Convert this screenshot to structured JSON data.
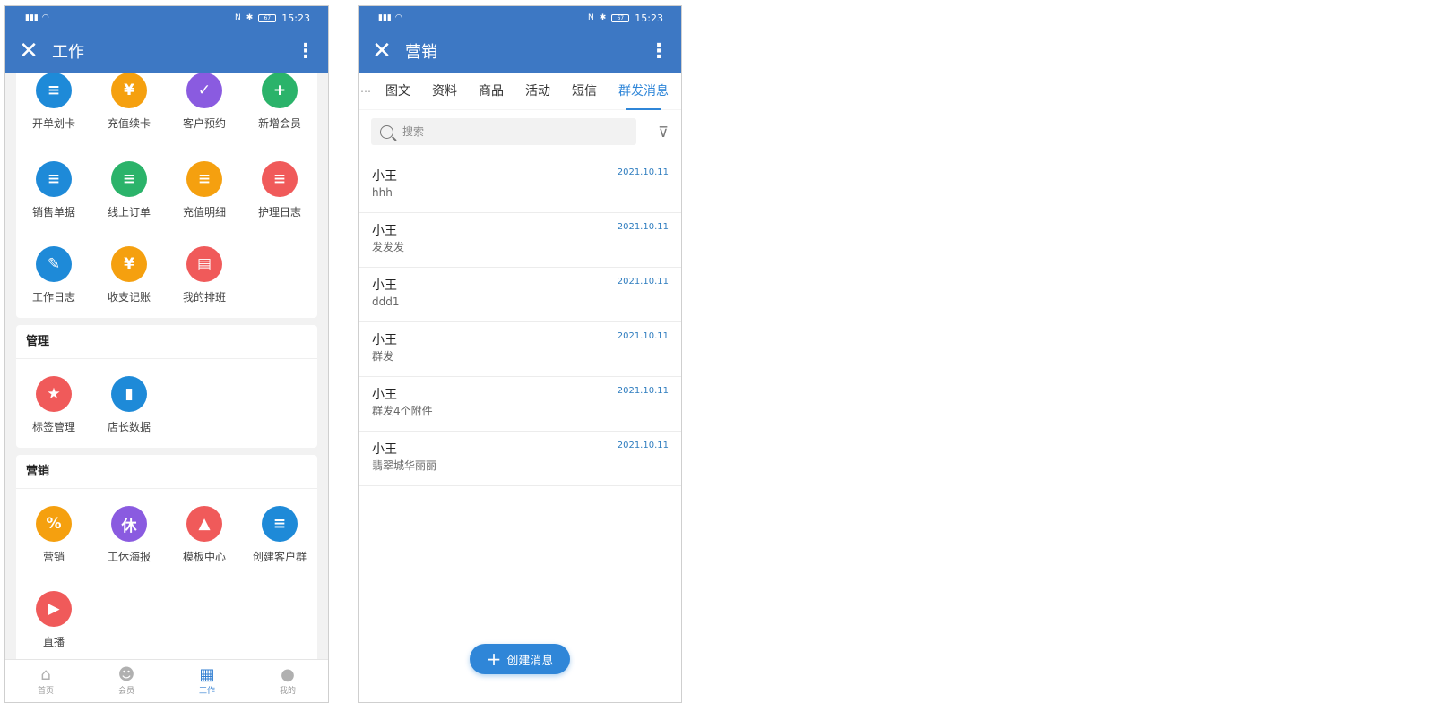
{
  "status_bar": {
    "time": "15:23",
    "battery": "67"
  },
  "work_screen": {
    "title": "工作",
    "top_items": [
      {
        "label": "开单划卡",
        "icon": "list-doc-icon",
        "glyph": "≡",
        "color": "#1e8ad8"
      },
      {
        "label": "充值续卡",
        "icon": "recharge-card-icon",
        "glyph": "¥",
        "color": "#f5a00f"
      },
      {
        "label": "客户预约",
        "icon": "calendar-check-icon",
        "glyph": "✓",
        "color": "#8a5be0"
      },
      {
        "label": "新增会员",
        "icon": "add-user-icon",
        "glyph": "+",
        "color": "#2bb36a"
      },
      {
        "label": "销售单据",
        "icon": "receipt-icon",
        "glyph": "≡",
        "color": "#1e8ad8"
      },
      {
        "label": "线上订单",
        "icon": "online-order-icon",
        "glyph": "≡",
        "color": "#2bb36a"
      },
      {
        "label": "充值明细",
        "icon": "recharge-detail-icon",
        "glyph": "≡",
        "color": "#f5a00f"
      },
      {
        "label": "护理日志",
        "icon": "care-log-icon",
        "glyph": "≡",
        "color": "#f05a5a"
      },
      {
        "label": "工作日志",
        "icon": "pen-icon",
        "glyph": "✎",
        "color": "#1e8ad8"
      },
      {
        "label": "收支记账",
        "icon": "ledger-icon",
        "glyph": "¥",
        "color": "#f5a00f"
      },
      {
        "label": "我的排班",
        "icon": "schedule-icon",
        "glyph": "▤",
        "color": "#f05a5a"
      }
    ],
    "sections": [
      {
        "title": "管理",
        "items": [
          {
            "label": "标签管理",
            "icon": "tag-star-icon",
            "glyph": "★",
            "color": "#f05a5a"
          },
          {
            "label": "店长数据",
            "icon": "bar-chart-icon",
            "glyph": "▮",
            "color": "#1e8ad8"
          }
        ]
      },
      {
        "title": "营销",
        "items": [
          {
            "label": "营销",
            "icon": "percent-icon",
            "glyph": "%",
            "color": "#f5a00f"
          },
          {
            "label": "工休海报",
            "icon": "rest-poster-icon",
            "glyph": "休",
            "color": "#8a5be0"
          },
          {
            "label": "模板中心",
            "icon": "image-template-icon",
            "glyph": "▲",
            "color": "#f05a5a"
          },
          {
            "label": "创建客户群",
            "icon": "create-group-icon",
            "glyph": "≡",
            "color": "#1e8ad8"
          },
          {
            "label": "直播",
            "icon": "live-video-icon",
            "glyph": "▶",
            "color": "#f05a5a"
          }
        ]
      }
    ],
    "nav": [
      {
        "label": "首页",
        "icon": "home-icon",
        "glyph": "⌂",
        "active": false
      },
      {
        "label": "会员",
        "icon": "member-icon",
        "glyph": "☻",
        "active": false
      },
      {
        "label": "工作",
        "icon": "grid-icon",
        "glyph": "▦",
        "active": true
      },
      {
        "label": "我的",
        "icon": "profile-icon",
        "glyph": "●",
        "active": false
      }
    ]
  },
  "marketing_screen": {
    "title": "营销",
    "tabs": [
      {
        "label": "⋯",
        "clip": true
      },
      {
        "label": "图文"
      },
      {
        "label": "资料"
      },
      {
        "label": "商品"
      },
      {
        "label": "活动"
      },
      {
        "label": "短信"
      },
      {
        "label": "群发消息",
        "active": true
      }
    ],
    "search": {
      "placeholder": "搜索"
    },
    "messages": [
      {
        "name": "小王",
        "text": "hhh",
        "date": "2021.10.11"
      },
      {
        "name": "小王",
        "text": "发发发",
        "date": "2021.10.11"
      },
      {
        "name": "小王",
        "text": "ddd1",
        "date": "2021.10.11"
      },
      {
        "name": "小王",
        "text": "群发",
        "date": "2021.10.11"
      },
      {
        "name": "小王",
        "text": "群发4个附件",
        "date": "2021.10.11"
      },
      {
        "name": "小王",
        "text": "翡翠城华丽丽",
        "date": "2021.10.11"
      }
    ],
    "create_button": "创建消息"
  }
}
